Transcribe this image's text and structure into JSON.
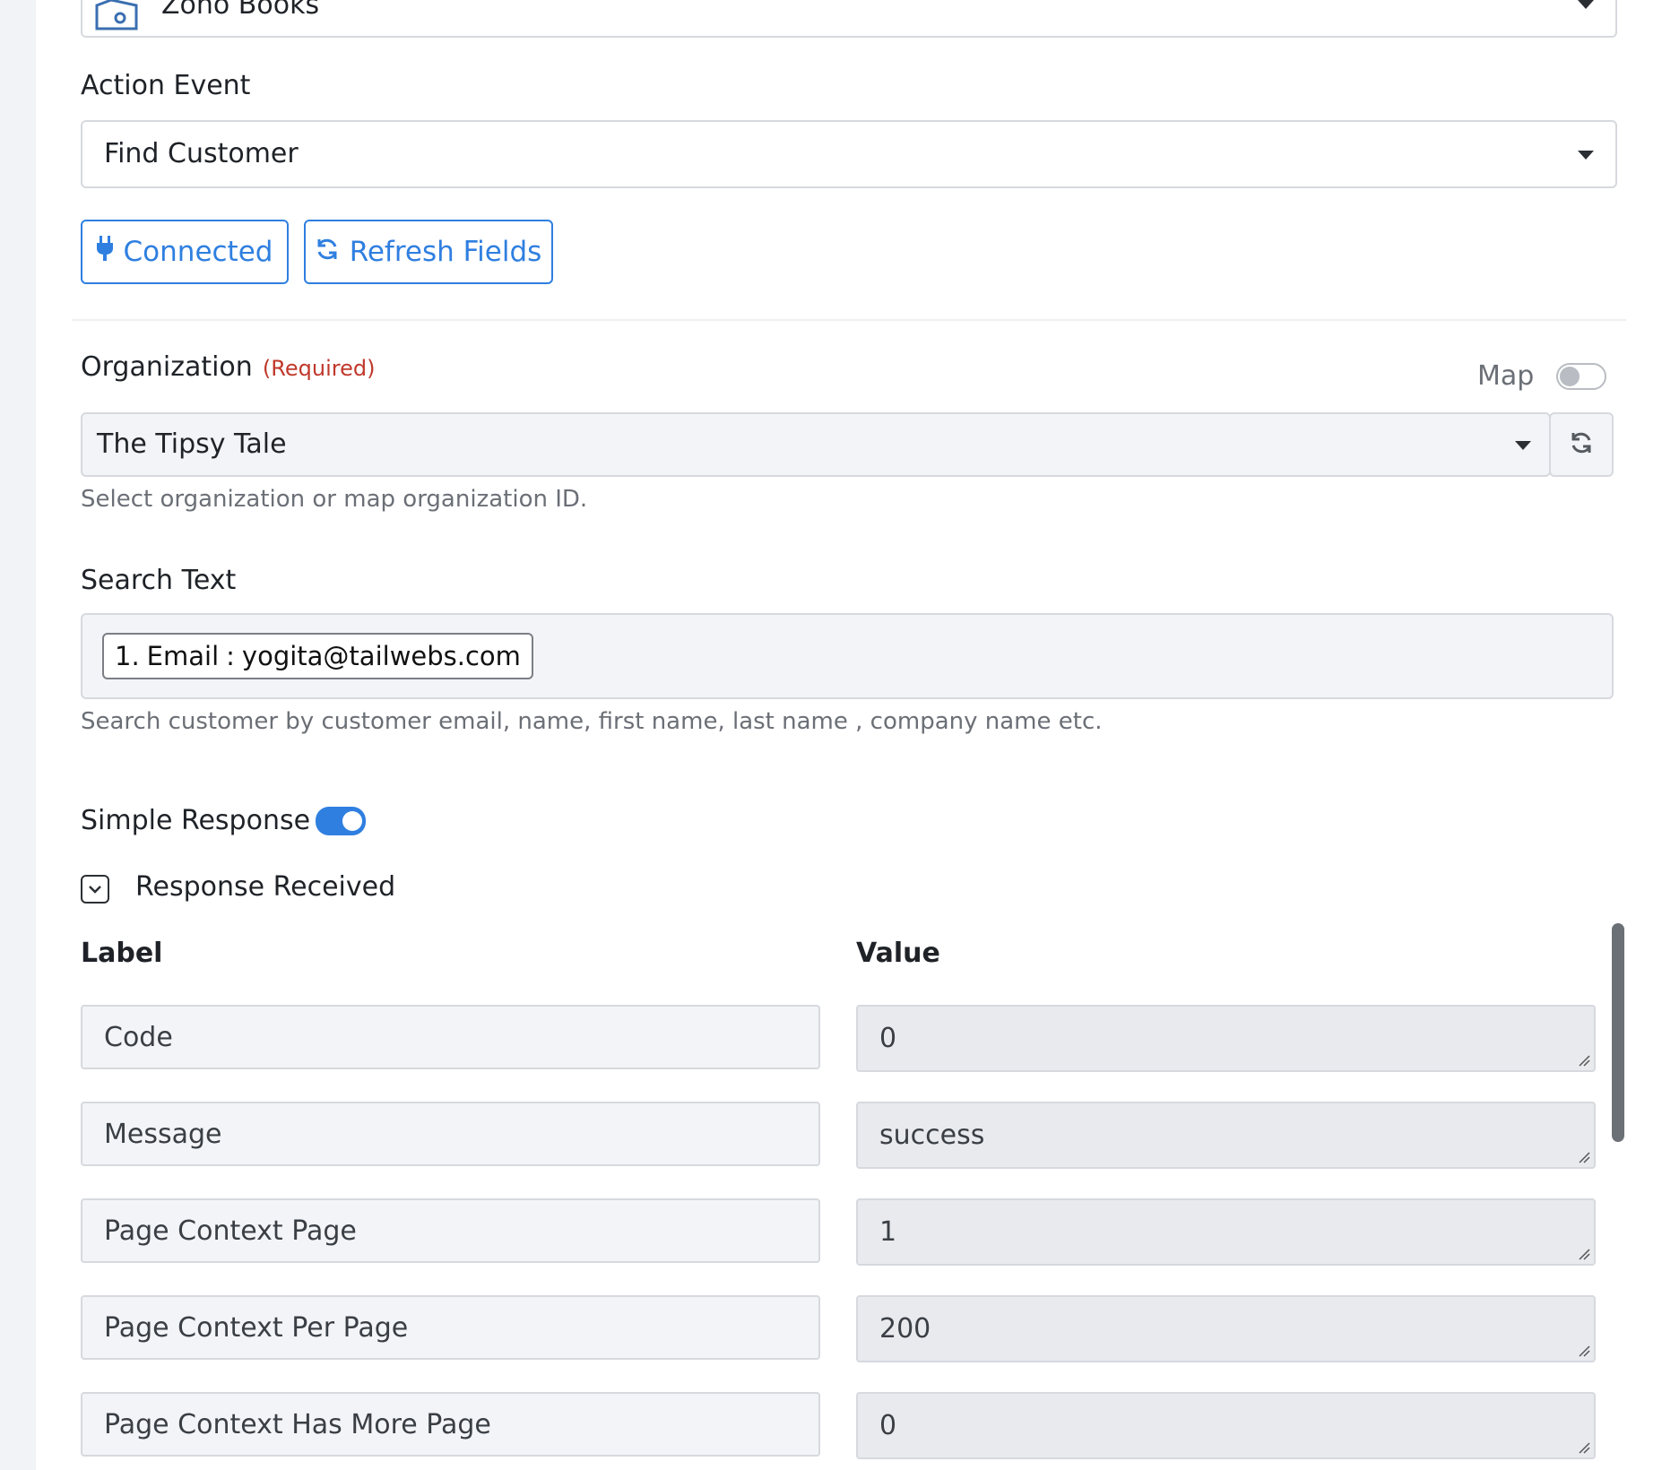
{
  "app": {
    "name": "Zoho Books"
  },
  "action_event": {
    "label": "Action Event",
    "selected": "Find Customer"
  },
  "buttons": {
    "connected": "Connected",
    "refresh": "Refresh Fields"
  },
  "organization": {
    "label": "Organization",
    "required": "(Required)",
    "map_label": "Map",
    "selected": "The Tipsy Tale",
    "help": "Select organization or map organization ID."
  },
  "search_text": {
    "label": "Search Text",
    "chip_index": "1.",
    "chip_field": "Email",
    "chip_sep": ":",
    "chip_value": "yogita@tailwebs.com",
    "help": "Search customer by customer email, name, first name, last name , company name etc."
  },
  "simple_response": {
    "label": "Simple Response",
    "enabled": true
  },
  "response_received": {
    "label": "Response Received",
    "headers": {
      "label": "Label",
      "value": "Value"
    },
    "rows": [
      {
        "label": "Code",
        "value": "0"
      },
      {
        "label": "Message",
        "value": "success"
      },
      {
        "label": "Page Context Page",
        "value": "1"
      },
      {
        "label": "Page Context Per Page",
        "value": "200"
      },
      {
        "label": "Page Context Has More Page",
        "value": "0"
      }
    ]
  },
  "colors": {
    "accent": "#2f7fe0",
    "required": "#c0392b",
    "toggle_off": "#d9dbdf"
  }
}
